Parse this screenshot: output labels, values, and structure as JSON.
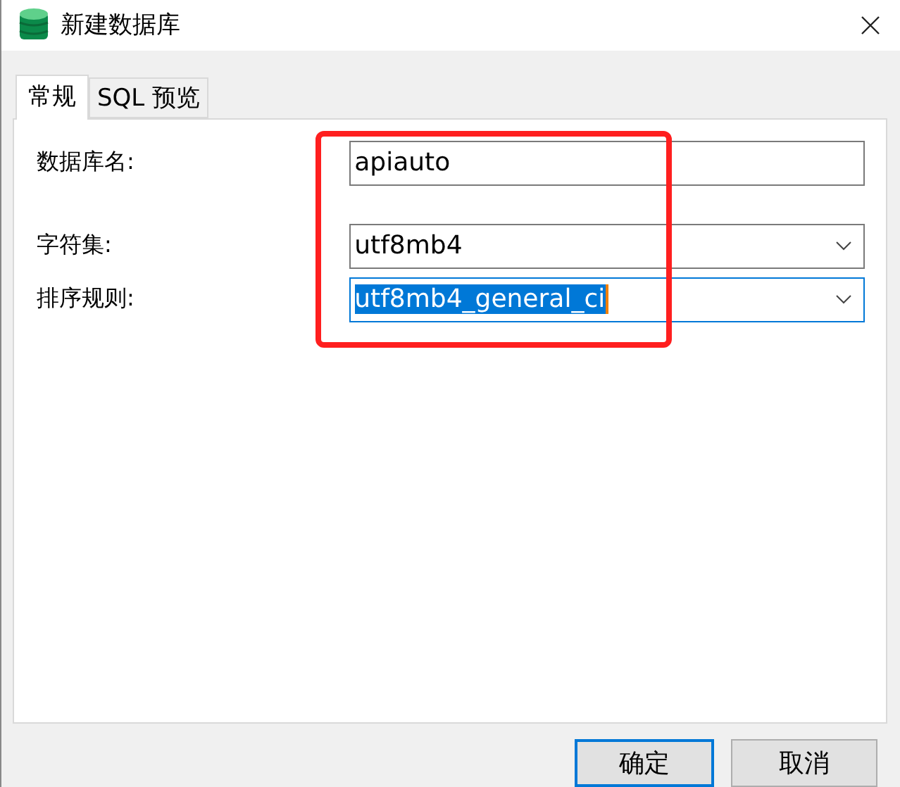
{
  "window": {
    "title": "新建数据库"
  },
  "tabs": [
    {
      "label": "常规",
      "selected": true
    },
    {
      "label": "SQL 预览",
      "selected": false
    }
  ],
  "fields": [
    {
      "label": "数据库名:",
      "kind": "text",
      "value": "apiauto",
      "focused": false
    },
    {
      "label": "字符集:",
      "kind": "select",
      "value": "utf8mb4",
      "focused": false
    },
    {
      "label": "排序规则:",
      "kind": "select",
      "value": "utf8mb4_general_ci",
      "focused": true
    }
  ],
  "buttons": [
    {
      "label": "确定",
      "default": true
    },
    {
      "label": "取消",
      "default": false
    }
  ]
}
